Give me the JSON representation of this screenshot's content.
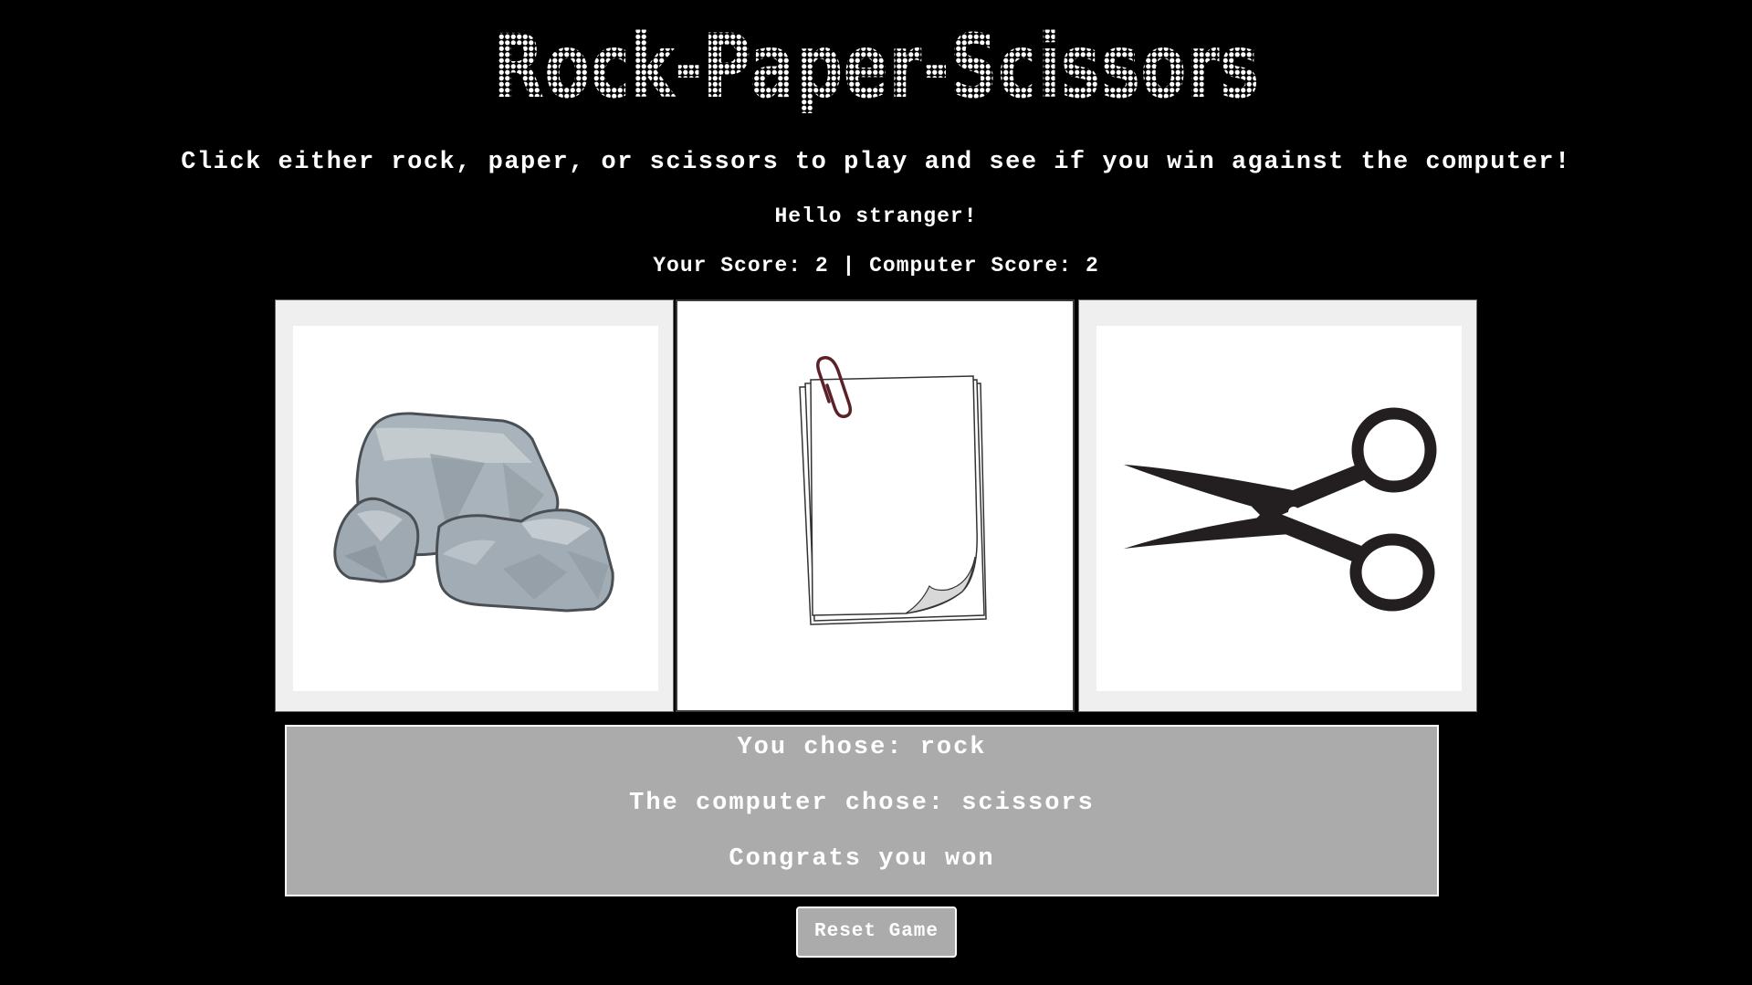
{
  "header": {
    "title": "Rock-Paper-Scissors",
    "instructions": "Click either rock, paper, or scissors to play and see if you win against the computer!",
    "greeting": "Hello stranger!"
  },
  "score": {
    "your_label": "Your Score:",
    "your_value": "2",
    "separator": "|",
    "computer_label": "Computer Score:",
    "computer_value": "2"
  },
  "choices": [
    {
      "id": "rock",
      "icon": "rock-icon",
      "selected": false
    },
    {
      "id": "paper",
      "icon": "paper-icon",
      "selected": true
    },
    {
      "id": "scissors",
      "icon": "scissors-icon",
      "selected": false
    }
  ],
  "result": {
    "player_choice_line": "You chose: rock",
    "computer_choice_line": "The computer chose: scissors",
    "outcome_line": "Congrats you won"
  },
  "controls": {
    "reset_label": "Reset Game"
  },
  "colors": {
    "background": "#000000",
    "text": "#ffffff",
    "result_panel": "#ababab",
    "tile_frame": "#efefef"
  }
}
